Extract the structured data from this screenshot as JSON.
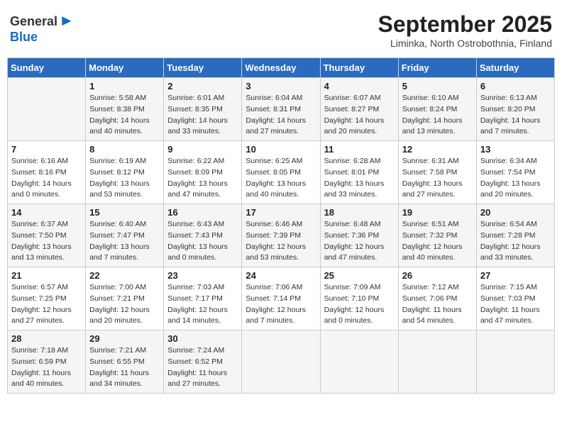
{
  "header": {
    "logo_general": "General",
    "logo_blue": "Blue",
    "month": "September 2025",
    "location": "Liminka, North Ostrobothnia, Finland"
  },
  "weekdays": [
    "Sunday",
    "Monday",
    "Tuesday",
    "Wednesday",
    "Thursday",
    "Friday",
    "Saturday"
  ],
  "weeks": [
    [
      {
        "day": "",
        "info": ""
      },
      {
        "day": "1",
        "info": "Sunrise: 5:58 AM\nSunset: 8:38 PM\nDaylight: 14 hours\nand 40 minutes."
      },
      {
        "day": "2",
        "info": "Sunrise: 6:01 AM\nSunset: 8:35 PM\nDaylight: 14 hours\nand 33 minutes."
      },
      {
        "day": "3",
        "info": "Sunrise: 6:04 AM\nSunset: 8:31 PM\nDaylight: 14 hours\nand 27 minutes."
      },
      {
        "day": "4",
        "info": "Sunrise: 6:07 AM\nSunset: 8:27 PM\nDaylight: 14 hours\nand 20 minutes."
      },
      {
        "day": "5",
        "info": "Sunrise: 6:10 AM\nSunset: 8:24 PM\nDaylight: 14 hours\nand 13 minutes."
      },
      {
        "day": "6",
        "info": "Sunrise: 6:13 AM\nSunset: 8:20 PM\nDaylight: 14 hours\nand 7 minutes."
      }
    ],
    [
      {
        "day": "7",
        "info": "Sunrise: 6:16 AM\nSunset: 8:16 PM\nDaylight: 14 hours\nand 0 minutes."
      },
      {
        "day": "8",
        "info": "Sunrise: 6:19 AM\nSunset: 8:12 PM\nDaylight: 13 hours\nand 53 minutes."
      },
      {
        "day": "9",
        "info": "Sunrise: 6:22 AM\nSunset: 8:09 PM\nDaylight: 13 hours\nand 47 minutes."
      },
      {
        "day": "10",
        "info": "Sunrise: 6:25 AM\nSunset: 8:05 PM\nDaylight: 13 hours\nand 40 minutes."
      },
      {
        "day": "11",
        "info": "Sunrise: 6:28 AM\nSunset: 8:01 PM\nDaylight: 13 hours\nand 33 minutes."
      },
      {
        "day": "12",
        "info": "Sunrise: 6:31 AM\nSunset: 7:58 PM\nDaylight: 13 hours\nand 27 minutes."
      },
      {
        "day": "13",
        "info": "Sunrise: 6:34 AM\nSunset: 7:54 PM\nDaylight: 13 hours\nand 20 minutes."
      }
    ],
    [
      {
        "day": "14",
        "info": "Sunrise: 6:37 AM\nSunset: 7:50 PM\nDaylight: 13 hours\nand 13 minutes."
      },
      {
        "day": "15",
        "info": "Sunrise: 6:40 AM\nSunset: 7:47 PM\nDaylight: 13 hours\nand 7 minutes."
      },
      {
        "day": "16",
        "info": "Sunrise: 6:43 AM\nSunset: 7:43 PM\nDaylight: 13 hours\nand 0 minutes."
      },
      {
        "day": "17",
        "info": "Sunrise: 6:46 AM\nSunset: 7:39 PM\nDaylight: 12 hours\nand 53 minutes."
      },
      {
        "day": "18",
        "info": "Sunrise: 6:48 AM\nSunset: 7:36 PM\nDaylight: 12 hours\nand 47 minutes."
      },
      {
        "day": "19",
        "info": "Sunrise: 6:51 AM\nSunset: 7:32 PM\nDaylight: 12 hours\nand 40 minutes."
      },
      {
        "day": "20",
        "info": "Sunrise: 6:54 AM\nSunset: 7:28 PM\nDaylight: 12 hours\nand 33 minutes."
      }
    ],
    [
      {
        "day": "21",
        "info": "Sunrise: 6:57 AM\nSunset: 7:25 PM\nDaylight: 12 hours\nand 27 minutes."
      },
      {
        "day": "22",
        "info": "Sunrise: 7:00 AM\nSunset: 7:21 PM\nDaylight: 12 hours\nand 20 minutes."
      },
      {
        "day": "23",
        "info": "Sunrise: 7:03 AM\nSunset: 7:17 PM\nDaylight: 12 hours\nand 14 minutes."
      },
      {
        "day": "24",
        "info": "Sunrise: 7:06 AM\nSunset: 7:14 PM\nDaylight: 12 hours\nand 7 minutes."
      },
      {
        "day": "25",
        "info": "Sunrise: 7:09 AM\nSunset: 7:10 PM\nDaylight: 12 hours\nand 0 minutes."
      },
      {
        "day": "26",
        "info": "Sunrise: 7:12 AM\nSunset: 7:06 PM\nDaylight: 11 hours\nand 54 minutes."
      },
      {
        "day": "27",
        "info": "Sunrise: 7:15 AM\nSunset: 7:03 PM\nDaylight: 11 hours\nand 47 minutes."
      }
    ],
    [
      {
        "day": "28",
        "info": "Sunrise: 7:18 AM\nSunset: 6:59 PM\nDaylight: 11 hours\nand 40 minutes."
      },
      {
        "day": "29",
        "info": "Sunrise: 7:21 AM\nSunset: 6:55 PM\nDaylight: 11 hours\nand 34 minutes."
      },
      {
        "day": "30",
        "info": "Sunrise: 7:24 AM\nSunset: 6:52 PM\nDaylight: 11 hours\nand 27 minutes."
      },
      {
        "day": "",
        "info": ""
      },
      {
        "day": "",
        "info": ""
      },
      {
        "day": "",
        "info": ""
      },
      {
        "day": "",
        "info": ""
      }
    ]
  ]
}
